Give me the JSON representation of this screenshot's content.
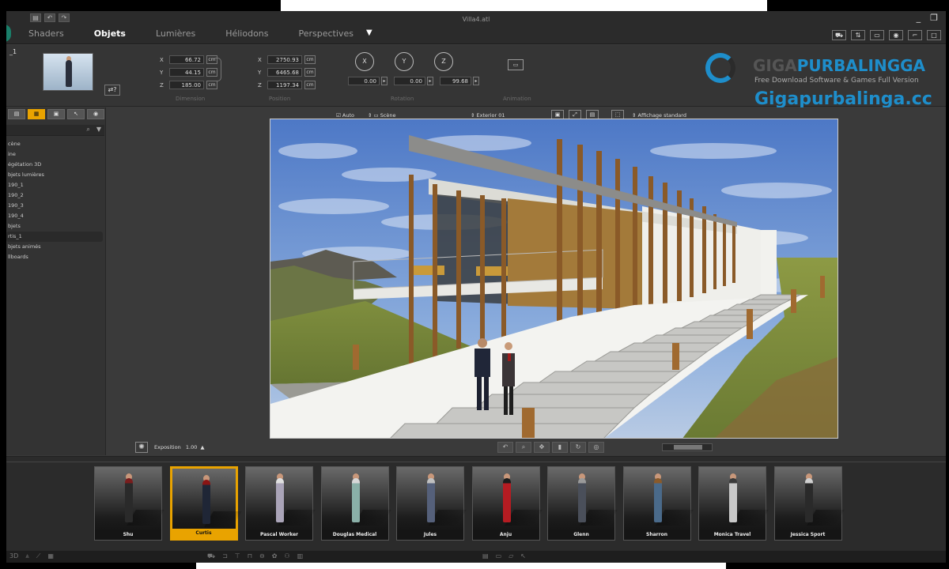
{
  "window": {
    "title": "Villa4.atl",
    "controls": [
      "_",
      "❐"
    ]
  },
  "menus": [
    {
      "label": "Shaders",
      "active": false
    },
    {
      "label": "Objets",
      "active": true
    },
    {
      "label": "Lumières",
      "active": false
    },
    {
      "label": "Héliodons",
      "active": false
    },
    {
      "label": "Perspectives",
      "active": false
    }
  ],
  "ribbon": {
    "object_label": "_1",
    "dimension": {
      "x": "66.72",
      "y": "44.15",
      "z": "185.00",
      "unit": "cm",
      "label": "Dimension"
    },
    "position": {
      "x": "2750.93",
      "y": "6465.68",
      "z": "1197.34",
      "unit": "cm",
      "label": "Position"
    },
    "rotation": {
      "x": "0.00",
      "y": "0.00",
      "z": "99.68",
      "label": "Rotation",
      "axes": [
        "X",
        "Y",
        "Z"
      ]
    },
    "animation_label": "Animation"
  },
  "watermark": {
    "title_prefix": "GIGA",
    "title": "PURBALINGGA",
    "subtitle": "Free Download Software & Games Full Version",
    "url": "Gigapurbalinga.cc"
  },
  "left_panel": {
    "tree": [
      "cène",
      "ine",
      "égétation 3D",
      "bjets lumières",
      "190_1",
      "190_2",
      "190_3",
      "190_4",
      "bjets",
      "rtis_1",
      "bjets animés",
      "llboards"
    ],
    "selected_index": 9
  },
  "viewport_toolbar": {
    "auto_label": "Auto",
    "scene_label": "Scène",
    "camera_label": "Exterior 01",
    "display_label": "Affichage standard"
  },
  "viewport_bottom": {
    "exposition_label": "Exposition",
    "exposition_value": "1.00"
  },
  "characters": [
    {
      "name": "Shu",
      "selected": false,
      "outfit": "#2a2a2a",
      "accent": "#7a1d1d"
    },
    {
      "name": "Curtis",
      "selected": true,
      "outfit": "#1f2636",
      "accent": "#8a1414"
    },
    {
      "name": "Pascal Worker",
      "selected": false,
      "outfit": "#aaa4b8",
      "accent": "#e0e0e0"
    },
    {
      "name": "Douglas Medical",
      "selected": false,
      "outfit": "#8ab0a8",
      "accent": "#d8d8d8"
    },
    {
      "name": "Jules",
      "selected": false,
      "outfit": "#55607a",
      "accent": "#c0c0c0"
    },
    {
      "name": "Anju",
      "selected": false,
      "outfit": "#b51c22",
      "accent": "#1c1c1c"
    },
    {
      "name": "Glenn",
      "selected": false,
      "outfit": "#4a4f5a",
      "accent": "#9a9a9a"
    },
    {
      "name": "Sharron",
      "selected": false,
      "outfit": "#4a6a8a",
      "accent": "#8a5a2a"
    },
    {
      "name": "Monica Travel",
      "selected": false,
      "outfit": "#c8c8c8",
      "accent": "#3a3a3a"
    },
    {
      "name": "Jessica Sport",
      "selected": false,
      "outfit": "#2a2a2a",
      "accent": "#d0d0d0"
    }
  ],
  "colors": {
    "accent": "#e9a300",
    "watermark_blue": "#1e8ecb"
  }
}
